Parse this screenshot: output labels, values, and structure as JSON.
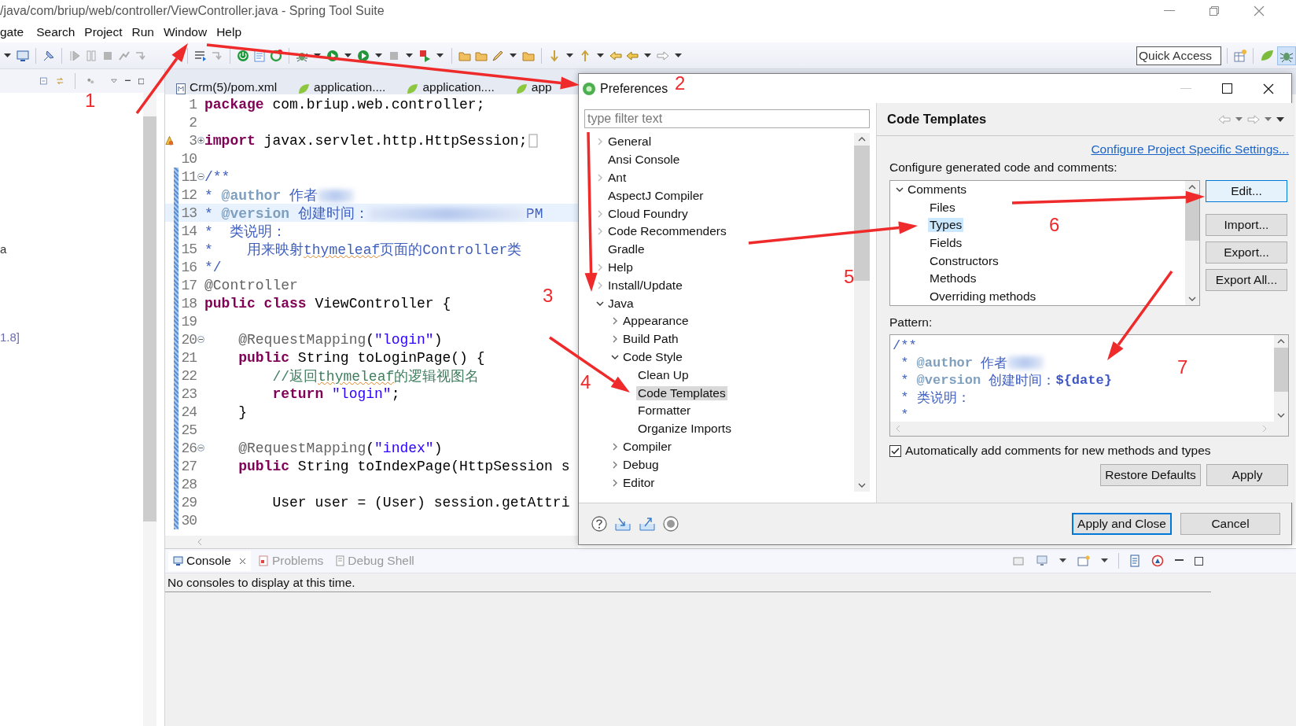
{
  "window": {
    "title": "/java/com/briup/web/controller/ViewController.java - Spring Tool Suite"
  },
  "menu": [
    "gate",
    "Search",
    "Project",
    "Run",
    "Window",
    "Help"
  ],
  "toolbar": {
    "quick_access": {
      "placeholder": "Quick Access"
    }
  },
  "side_panel": {
    "texts": [
      "a",
      "1.8]"
    ]
  },
  "editor": {
    "tabs": [
      {
        "label": "Crm(5)/pom.xml",
        "kind": "xml",
        "selected": false
      },
      {
        "label": "application....",
        "kind": "spring",
        "selected": false
      },
      {
        "label": "application....",
        "kind": "spring",
        "selected": false
      },
      {
        "label": "app",
        "kind": "spring",
        "selected": false
      }
    ],
    "lines": [
      {
        "number": "1",
        "current": false,
        "changed": false,
        "tokens": [
          {
            "kind": "keyword",
            "text": "package"
          },
          {
            "kind": "plain",
            "text": " com.briup.web.controller;"
          }
        ]
      },
      {
        "number": "2",
        "current": false,
        "changed": false
      },
      {
        "number": "3",
        "current": false,
        "changed": false,
        "collapsed": true,
        "warning": true,
        "tokens": [
          {
            "kind": "keyword",
            "text": "import"
          },
          {
            "kind": "plain",
            "text": " javax.servlet.http.HttpSession;"
          }
        ]
      },
      {
        "number": "10",
        "current": false,
        "changed": false
      },
      {
        "number": "11",
        "current": false,
        "changed": true,
        "collapsible": true,
        "tokens": [
          {
            "kind": "javadoc",
            "text": "/**"
          }
        ]
      },
      {
        "number": "12",
        "current": false,
        "changed": true,
        "tokens": [
          {
            "kind": "javadoc",
            "text": "* "
          },
          {
            "kind": "doctag",
            "text": "@author"
          },
          {
            "kind": "javadoc",
            "text": " 作者"
          },
          {
            "kind": "blurred",
            "long": false
          }
        ]
      },
      {
        "number": "13",
        "current": true,
        "changed": true,
        "tokens": [
          {
            "kind": "javadoc",
            "text": "* "
          },
          {
            "kind": "doctag",
            "text": "@version"
          },
          {
            "kind": "javadoc",
            "text": " 创建时间："
          },
          {
            "kind": "blurred",
            "long": true
          },
          {
            "kind": "javadoc",
            "text": "PM"
          }
        ]
      },
      {
        "number": "14",
        "current": false,
        "changed": true,
        "tokens": [
          {
            "kind": "javadoc",
            "text": "*  类说明："
          }
        ]
      },
      {
        "number": "15",
        "current": false,
        "changed": true,
        "tokens": [
          {
            "kind": "javadoc",
            "text": "*    用来映射"
          },
          {
            "kind": "javadoc",
            "text": "thymeleaf",
            "misspelled": true
          },
          {
            "kind": "javadoc",
            "text": "页面的Controller类"
          }
        ]
      },
      {
        "number": "16",
        "current": false,
        "changed": true,
        "tokens": [
          {
            "kind": "javadoc",
            "text": "*/"
          }
        ]
      },
      {
        "number": "17",
        "current": false,
        "changed": true,
        "tokens": [
          {
            "kind": "annotation",
            "text": "@Controller"
          }
        ]
      },
      {
        "number": "18",
        "current": false,
        "changed": true,
        "tokens": [
          {
            "kind": "keyword",
            "text": "public"
          },
          {
            "kind": "keyword",
            "text": " class"
          },
          {
            "kind": "plain",
            "text": " ViewController {"
          }
        ]
      },
      {
        "number": "19",
        "current": false,
        "changed": true
      },
      {
        "number": "20",
        "current": false,
        "changed": true,
        "collapsible": true,
        "tokens": [
          {
            "kind": "annotation",
            "text": "    @RequestMapping"
          },
          {
            "kind": "plain",
            "text": "("
          },
          {
            "kind": "string",
            "text": "\"login\""
          },
          {
            "kind": "plain",
            "text": ")"
          }
        ]
      },
      {
        "number": "21",
        "current": false,
        "changed": true,
        "tokens": [
          {
            "kind": "keyword",
            "text": "    public"
          },
          {
            "kind": "plain",
            "text": " String toLoginPage() {"
          }
        ]
      },
      {
        "number": "22",
        "current": false,
        "changed": true,
        "tokens": [
          {
            "kind": "line_comment",
            "text": "        //返回"
          },
          {
            "kind": "line_comment",
            "text": "thymeleaf",
            "misspelled": true
          },
          {
            "kind": "line_comment",
            "text": "的逻辑视图名"
          }
        ]
      },
      {
        "number": "23",
        "current": false,
        "changed": true,
        "tokens": [
          {
            "kind": "keyword",
            "text": "        return"
          },
          {
            "kind": "string",
            "text": " \"login\""
          },
          {
            "kind": "plain",
            "text": ";"
          }
        ]
      },
      {
        "number": "24",
        "current": false,
        "changed": true,
        "tokens": [
          {
            "kind": "plain",
            "text": "    }"
          }
        ]
      },
      {
        "number": "25",
        "current": false,
        "changed": true
      },
      {
        "number": "26",
        "current": false,
        "changed": true,
        "collapsible": true,
        "tokens": [
          {
            "kind": "annotation",
            "text": "    @RequestMapping"
          },
          {
            "kind": "plain",
            "text": "("
          },
          {
            "kind": "string",
            "text": "\"index\""
          },
          {
            "kind": "plain",
            "text": ")"
          }
        ]
      },
      {
        "number": "27",
        "current": false,
        "changed": true,
        "tokens": [
          {
            "kind": "keyword",
            "text": "    public"
          },
          {
            "kind": "plain",
            "text": " String toIndexPage(HttpSession s"
          }
        ]
      },
      {
        "number": "28",
        "current": false,
        "changed": true
      },
      {
        "number": "29",
        "current": false,
        "changed": true,
        "tokens": [
          {
            "kind": "plain",
            "text": "        User user = (User) session.getAttri"
          }
        ]
      },
      {
        "number": "30",
        "current": false,
        "changed": true
      }
    ]
  },
  "dialog": {
    "title": "Preferences",
    "filter": {
      "placeholder": "type filter text"
    },
    "tree": [
      {
        "label": "General",
        "expandable": true,
        "expanded": false,
        "selected": false
      },
      {
        "label": "Ansi Console",
        "expandable": false,
        "expanded": false,
        "selected": false
      },
      {
        "label": "Ant",
        "expandable": true,
        "expanded": false,
        "selected": false
      },
      {
        "label": "AspectJ Compiler",
        "expandable": false,
        "expanded": false,
        "selected": false
      },
      {
        "label": "Cloud Foundry",
        "expandable": true,
        "expanded": false,
        "selected": false
      },
      {
        "label": "Code Recommenders",
        "expandable": true,
        "expanded": false,
        "selected": false
      },
      {
        "label": "Gradle",
        "expandable": false,
        "expanded": false,
        "selected": false
      },
      {
        "label": "Help",
        "expandable": true,
        "expanded": false,
        "selected": false
      },
      {
        "label": "Install/Update",
        "expandable": true,
        "expanded": false,
        "selected": false
      },
      {
        "label": "Java",
        "expandable": true,
        "expanded": true,
        "selected": false,
        "children": [
          {
            "label": "Appearance",
            "expandable": true,
            "expanded": false,
            "selected": false
          },
          {
            "label": "Build Path",
            "expandable": true,
            "expanded": false,
            "selected": false
          },
          {
            "label": "Code Style",
            "expandable": true,
            "expanded": true,
            "selected": false,
            "children": [
              {
                "label": "Clean Up",
                "expandable": false,
                "expanded": false,
                "selected": false
              },
              {
                "label": "Code Templates",
                "expandable": false,
                "expanded": false,
                "selected": true
              },
              {
                "label": "Formatter",
                "expandable": false,
                "expanded": false,
                "selected": false
              },
              {
                "label": "Organize Imports",
                "expandable": false,
                "expanded": false,
                "selected": false
              }
            ]
          },
          {
            "label": "Compiler",
            "expandable": true,
            "expanded": false,
            "selected": false
          },
          {
            "label": "Debug",
            "expandable": true,
            "expanded": false,
            "selected": false
          },
          {
            "label": "Editor",
            "expandable": true,
            "expanded": false,
            "selected": false
          }
        ]
      }
    ],
    "page": {
      "title": "Code Templates",
      "link": "Configure Project Specific Settings...",
      "description": "Configure generated code and comments:",
      "templates": [
        {
          "label": "Comments",
          "expandable": true,
          "expanded": true,
          "selected": false,
          "children": [
            {
              "label": "Files",
              "expandable": false,
              "expanded": false,
              "selected": false
            },
            {
              "label": "Types",
              "expandable": false,
              "expanded": false,
              "selected": true
            },
            {
              "label": "Fields",
              "expandable": false,
              "expanded": false,
              "selected": false
            },
            {
              "label": "Constructors",
              "expandable": false,
              "expanded": false,
              "selected": false
            },
            {
              "label": "Methods",
              "expandable": false,
              "expanded": false,
              "selected": false
            },
            {
              "label": "Overriding methods",
              "expandable": false,
              "expanded": false,
              "selected": false
            }
          ]
        }
      ],
      "side_buttons": [
        {
          "label": "Edit...",
          "focused": true
        },
        {
          "label": "Import...",
          "focused": false
        },
        {
          "label": "Export...",
          "focused": false
        },
        {
          "label": "Export All...",
          "focused": false
        }
      ],
      "pattern_label": "Pattern:",
      "pattern": [
        {
          "tokens": [
            {
              "kind": "javadoc",
              "text": "/**"
            }
          ]
        },
        {
          "tokens": [
            {
              "kind": "javadoc",
              "text": " * "
            },
            {
              "kind": "doctag",
              "text": "@author"
            },
            {
              "kind": "javadoc",
              "text": " 作者"
            },
            {
              "kind": "blurred",
              "long": false
            }
          ]
        },
        {
          "tokens": [
            {
              "kind": "javadoc",
              "text": " * "
            },
            {
              "kind": "doctag",
              "text": "@version"
            },
            {
              "kind": "javadoc",
              "text": " 创建时间："
            },
            {
              "kind": "variable",
              "text": "${date}"
            }
          ]
        },
        {
          "tokens": [
            {
              "kind": "javadoc",
              "text": " * "
            },
            {
              "kind": "javadoc",
              "text": "类说明："
            }
          ]
        },
        {
          "tokens": [
            {
              "kind": "javadoc",
              "text": " *"
            }
          ]
        }
      ],
      "auto_comments": {
        "label": "Automatically add comments for new methods and types",
        "checked": true
      },
      "buttons": [
        "Restore Defaults",
        "Apply"
      ]
    },
    "footer_buttons": [
      {
        "label": "Apply and Close",
        "default": true
      },
      {
        "label": "Cancel",
        "default": false
      }
    ]
  },
  "console": {
    "tabs": [
      {
        "label": "Console",
        "selected": true,
        "closable": true
      },
      {
        "label": "Problems",
        "selected": false,
        "closable": false
      },
      {
        "label": "Debug Shell",
        "selected": false,
        "closable": false
      }
    ],
    "message": "No consoles to display at this time."
  },
  "annotations": [
    "1",
    "2",
    "3",
    "4",
    "5",
    "6",
    "7"
  ]
}
